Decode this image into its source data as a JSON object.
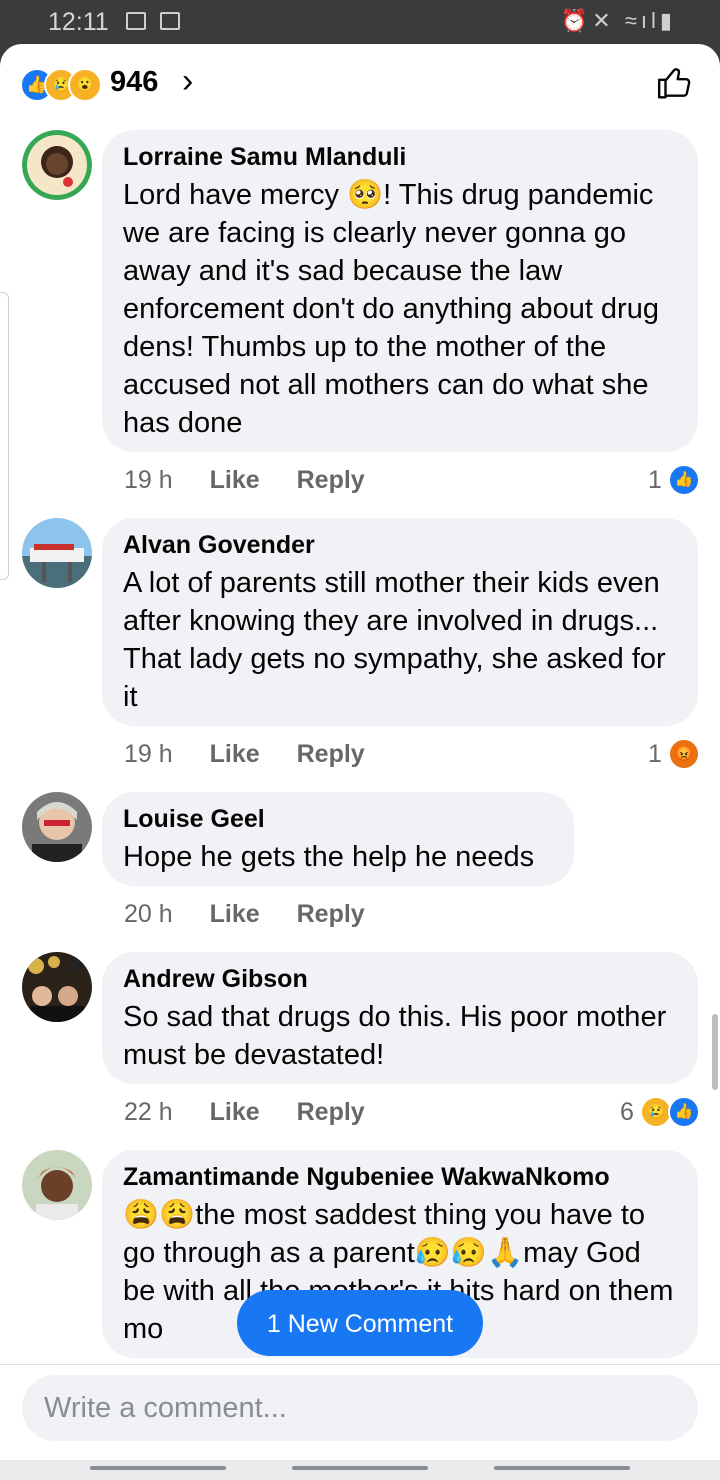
{
  "status_bar": {
    "time": "12:11"
  },
  "header": {
    "reaction_count": "946",
    "reaction_icons": [
      "like-icon",
      "sad-icon",
      "wow-icon"
    ]
  },
  "comments": [
    {
      "author": "Lorraine Samu Mlanduli",
      "text": "Lord have mercy 🥺! This drug pandemic we are facing is clearly never gonna go away and it's sad because the law enforcement don't do anything about drug dens! Thumbs up to the mother of the accused not all mothers can do what she has done",
      "time": "19 h",
      "like_label": "Like",
      "reply_label": "Reply",
      "reaction_count": "1",
      "reactions": [
        "like-icon"
      ]
    },
    {
      "author": "Alvan Govender",
      "text": "A lot of parents still mother their kids even after knowing they are involved in drugs... That lady gets no sympathy, she asked for it",
      "time": "19 h",
      "like_label": "Like",
      "reply_label": "Reply",
      "reaction_count": "1",
      "reactions": [
        "angry-icon"
      ]
    },
    {
      "author": "Louise Geel",
      "text": "Hope he gets the help he needs",
      "time": "20 h",
      "like_label": "Like",
      "reply_label": "Reply"
    },
    {
      "author": "Andrew Gibson",
      "text": "So sad that drugs do this. His poor mother must be devastated!",
      "time": "22 h",
      "like_label": "Like",
      "reply_label": "Reply",
      "reaction_count": "6",
      "reactions": [
        "sad-icon",
        "like-icon"
      ]
    },
    {
      "author": "Zamantimande Ngubeniee WakwaNkomo",
      "text": "😩😩the most saddest thing you have to go through as a parent😥😥🙏may God be with all the mother's it hits hard on them mo"
    }
  ],
  "new_comment_label": "1 New Comment",
  "composer": {
    "placeholder": "Write a comment..."
  },
  "colors": {
    "accent": "#1877f2",
    "bubble": "#f0f2f5",
    "secondary_text": "#65676b"
  }
}
